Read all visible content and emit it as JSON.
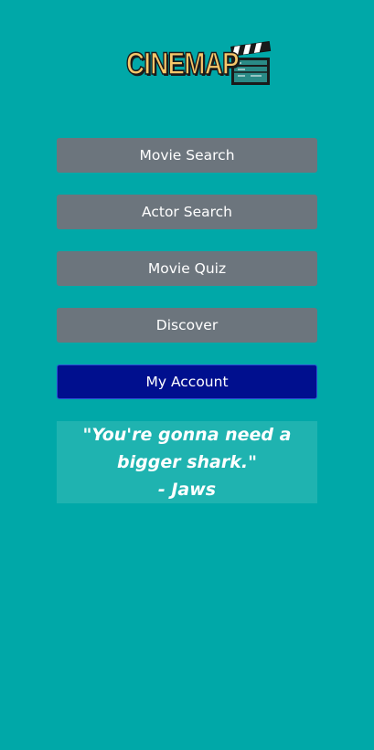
{
  "app": {
    "logo_text": "CINEMAP",
    "logo_icon": "clapperboard-icon"
  },
  "menu": {
    "movie_search": "Movie Search",
    "actor_search": "Actor Search",
    "movie_quiz": "Movie Quiz",
    "discover": "Discover",
    "my_account": "My Account"
  },
  "quote": {
    "text": "\"You're gonna need a bigger shark.\"",
    "source": "- Jaws"
  },
  "colors": {
    "background": "#00a8a8",
    "button": "#6c757d",
    "primary_button": "#000f8e",
    "quote_box": "#1fb3b0",
    "logo_text": "#f6c76a"
  }
}
